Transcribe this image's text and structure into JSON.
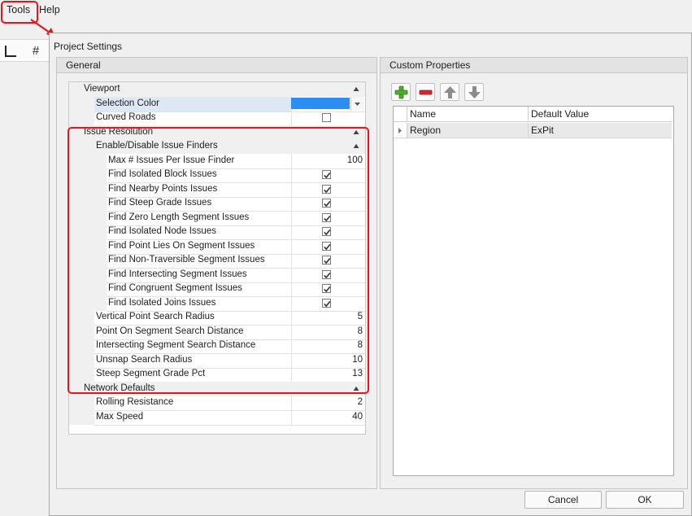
{
  "menu": {
    "tools": "Tools",
    "help": "Help"
  },
  "dialog": {
    "title": "Project Settings",
    "general": {
      "header": "General",
      "viewport": {
        "label": "Viewport",
        "selection_color": {
          "label": "Selection Color",
          "color": "#2c8ef2"
        },
        "curved_roads": {
          "label": "Curved Roads",
          "checked": false
        }
      },
      "issue_resolution": {
        "label": "Issue Resolution",
        "finders_label": "Enable/Disable Issue Finders",
        "max_issues": {
          "label": "Max # Issues Per Issue Finder",
          "value": "100"
        },
        "finders": [
          {
            "label": "Find Isolated Block Issues",
            "checked": true
          },
          {
            "label": "Find Nearby Points Issues",
            "checked": true
          },
          {
            "label": "Find Steep Grade Issues",
            "checked": true
          },
          {
            "label": "Find Zero Length Segment Issues",
            "checked": true
          },
          {
            "label": "Find Isolated Node Issues",
            "checked": true
          },
          {
            "label": "Find Point Lies On Segment Issues",
            "checked": true
          },
          {
            "label": "Find Non-Traversible Segment Issues",
            "checked": true
          },
          {
            "label": "Find Intersecting Segment Issues",
            "checked": true
          },
          {
            "label": "Find Congruent Segment Issues",
            "checked": true
          },
          {
            "label": "Find Isolated Joins Issues",
            "checked": true
          }
        ],
        "props": [
          {
            "label": "Vertical Point Search Radius",
            "value": "5"
          },
          {
            "label": "Point On Segment Search Distance",
            "value": "8"
          },
          {
            "label": "Intersecting Segment Search Distance",
            "value": "8"
          },
          {
            "label": "Unsnap Search Radius",
            "value": "10"
          },
          {
            "label": "Steep Segment Grade Pct",
            "value": "13"
          }
        ]
      },
      "network_defaults": {
        "label": "Network Defaults",
        "props": [
          {
            "label": "Rolling Resistance",
            "value": "2"
          },
          {
            "label": "Max Speed",
            "value": "40"
          }
        ]
      }
    },
    "custom_properties": {
      "header": "Custom Properties",
      "columns": [
        "Name",
        "Default Value"
      ],
      "rows": [
        {
          "name": "Region",
          "default": "ExPit"
        }
      ]
    },
    "buttons": {
      "cancel": "Cancel",
      "ok": "OK"
    }
  },
  "colors": {
    "highlight": "#e8141b",
    "add": "#4caf2a",
    "remove": "#d9262b"
  }
}
